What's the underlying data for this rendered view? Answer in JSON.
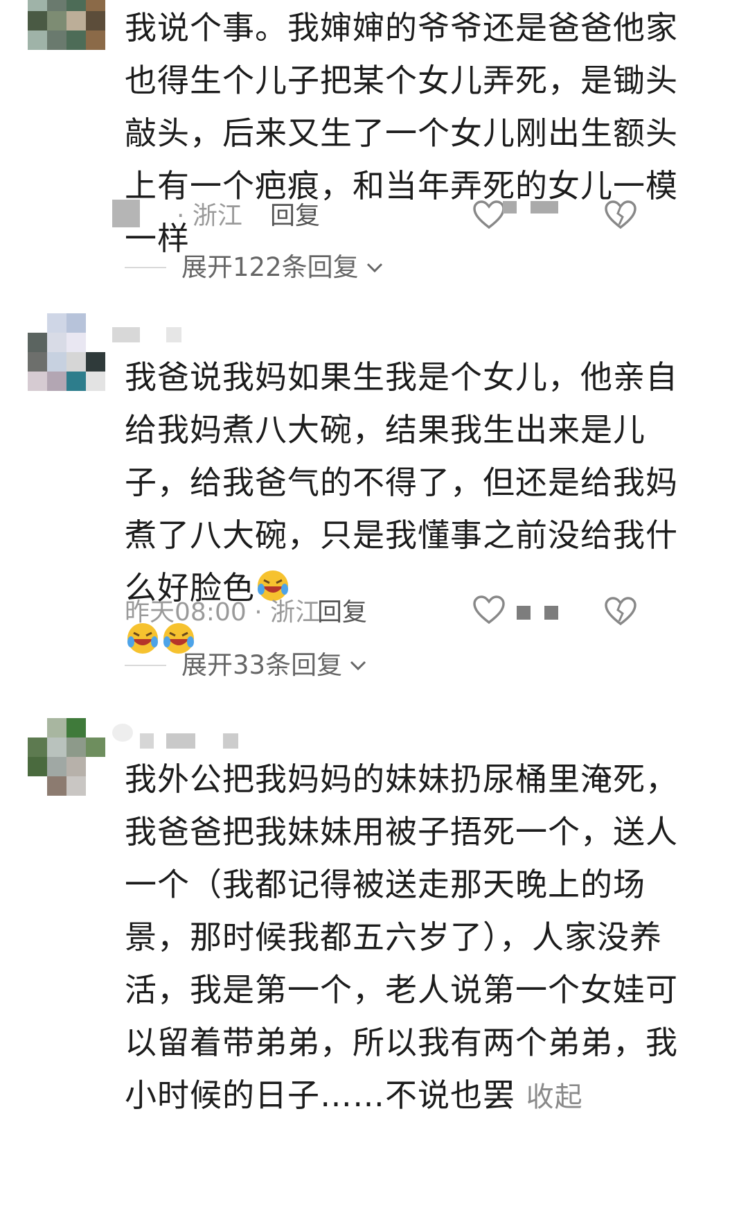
{
  "comments": [
    {
      "text": "我说个事。我婶婶的爷爷还是爸爸他家也得生个儿子把某个女儿弄死，是锄头敲头，后来又生了一个女儿刚出生额头上有一个疤痕，和当年弄死的女儿一模一样",
      "meta": "· 浙江",
      "reply_label": "回复",
      "expand_label": "展开122条回复",
      "avatar_colors": [
        "#4a5a44",
        "#7d8c73",
        "#bcae98",
        "#5c4d3a",
        "#9fb3a8",
        "#6a7a6e",
        "#4d6c57",
        "#8b6a48"
      ]
    },
    {
      "text": "我爸说我妈如果生我是个女儿，他亲自给我妈煮八大碗，结果我生出来是儿子，给我爸气的不得了，但还是给我妈煮了八大碗，只是我懂事之前没给我什么好脸色",
      "meta": "昨天08:00 · 浙江",
      "reply_label": "回复",
      "expand_label": "展开33条回复",
      "avatar_colors": [
        "#ffffff",
        "#cfd6e6",
        "#b7c3da",
        "#ffffff",
        "#5b6460",
        "#d8dbe6",
        "#e9e7f2",
        "#ffffff",
        "#6d6f6c",
        "#c7d1e0",
        "#d6d6d6",
        "#2f3a3a",
        "#d6cbd2",
        "#b3a6b3",
        "#2d7d8c",
        "#e3e3e3"
      ]
    },
    {
      "text": "我外公把我妈妈的妹妹扔尿桶里淹死，我爸爸把我妹妹用被子捂死一个，送人一个（我都记得被送走那天晚上的场景，那时候我都五六岁了），人家没养活，我是第一个，老人说第一个女娃可以留着带弟弟，所以我有两个弟弟，我小时候的日子……不说也罢",
      "collapse_label": "收起",
      "avatar_colors": [
        "#ffffff",
        "#a8b6a0",
        "#3f7a3a",
        "#ffffff",
        "#5d7a50",
        "#b9c2bd",
        "#8d9a8a",
        "#6e8e5e",
        "#4a6a3e",
        "#a0a8a4",
        "#b7b1aa",
        "#ffffff",
        "#ffffff",
        "#8c7b70",
        "#c9c6c3",
        "#ffffff"
      ]
    }
  ],
  "icons": {
    "like": "heart-icon",
    "dislike": "broken-heart-icon",
    "expand": "chevron-down-icon",
    "emoji": "rofl-emoji"
  }
}
